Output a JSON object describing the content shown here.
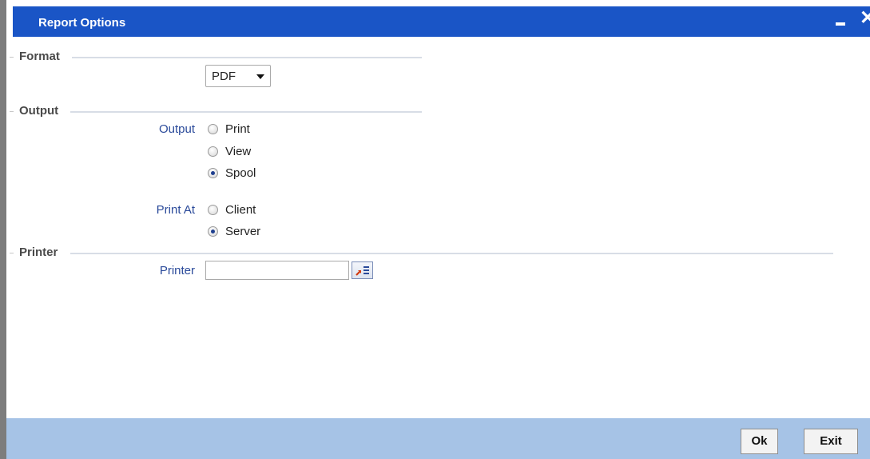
{
  "window": {
    "title": "Report Options",
    "colors": {
      "titlebar": "#1a55c6",
      "footer": "#a6c3e6",
      "label": "#2a4a9a"
    }
  },
  "sections": {
    "format": "Format",
    "output": "Output",
    "printer": "Printer"
  },
  "format": {
    "selected": "PDF"
  },
  "output": {
    "label": "Output",
    "options": [
      "Print",
      "View",
      "Spool"
    ],
    "selected": "Spool"
  },
  "print_at": {
    "label": "Print At",
    "options": [
      "Client",
      "Server"
    ],
    "selected": "Server"
  },
  "printer": {
    "label": "Printer",
    "value": "",
    "lov_icon": "list-of-values-icon"
  },
  "buttons": {
    "ok": "Ok",
    "exit": "Exit"
  }
}
